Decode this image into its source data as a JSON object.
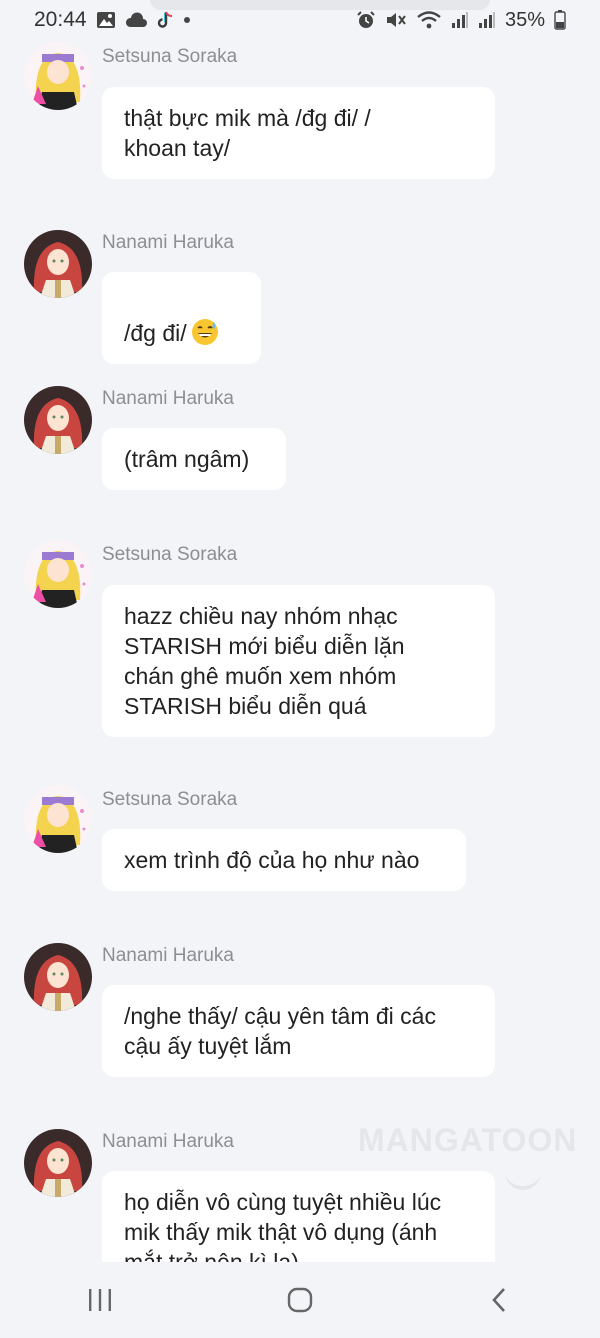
{
  "status_bar": {
    "time": "20:44",
    "battery": "35%",
    "left_icons": [
      "image-icon",
      "cloud-icon",
      "tiktok-icon",
      "dot-icon"
    ],
    "right_icons": [
      "alarm-icon",
      "mute-icon",
      "wifi-icon",
      "signal-icon",
      "signal-icon",
      "battery-icon"
    ]
  },
  "messages": [
    {
      "sender": "Setsuna Soraka",
      "avatar": "blonde",
      "text": "thật bực mik mà /đg đi/ /\nkhoan tay/"
    },
    {
      "sender": "Nanami Haruka",
      "avatar": "redhead",
      "text": "/đg đi/",
      "emoji": "grinning-sweat-emoji"
    },
    {
      "sender": "Nanami Haruka",
      "avatar": "redhead",
      "text": "(trâm ngâm)"
    },
    {
      "sender": "Setsuna Soraka",
      "avatar": "blonde",
      "text": "hazz chiều nay nhóm nhạc\nSTARISH mới biểu diễn lặn\nchán ghê muốn xem nhóm\nSTARISH biểu diễn quá"
    },
    {
      "sender": "Setsuna Soraka",
      "avatar": "blonde",
      "text": "xem trình độ của họ như nào"
    },
    {
      "sender": "Nanami Haruka",
      "avatar": "redhead",
      "text": "/nghe thấy/ cậu yên tâm đi các\ncậu ấy tuyệt lắm"
    },
    {
      "sender": "Nanami Haruka",
      "avatar": "redhead",
      "text": "họ diễn vô cùng tuyệt nhiều lúc\nmik thấy mik thật vô dụng (ánh\nmắt trở nên kì lạ)"
    }
  ],
  "watermark": "MANGATOON",
  "nav": {
    "recent_icon": "recent-apps-icon",
    "home_icon": "home-icon",
    "back_icon": "back-icon"
  }
}
